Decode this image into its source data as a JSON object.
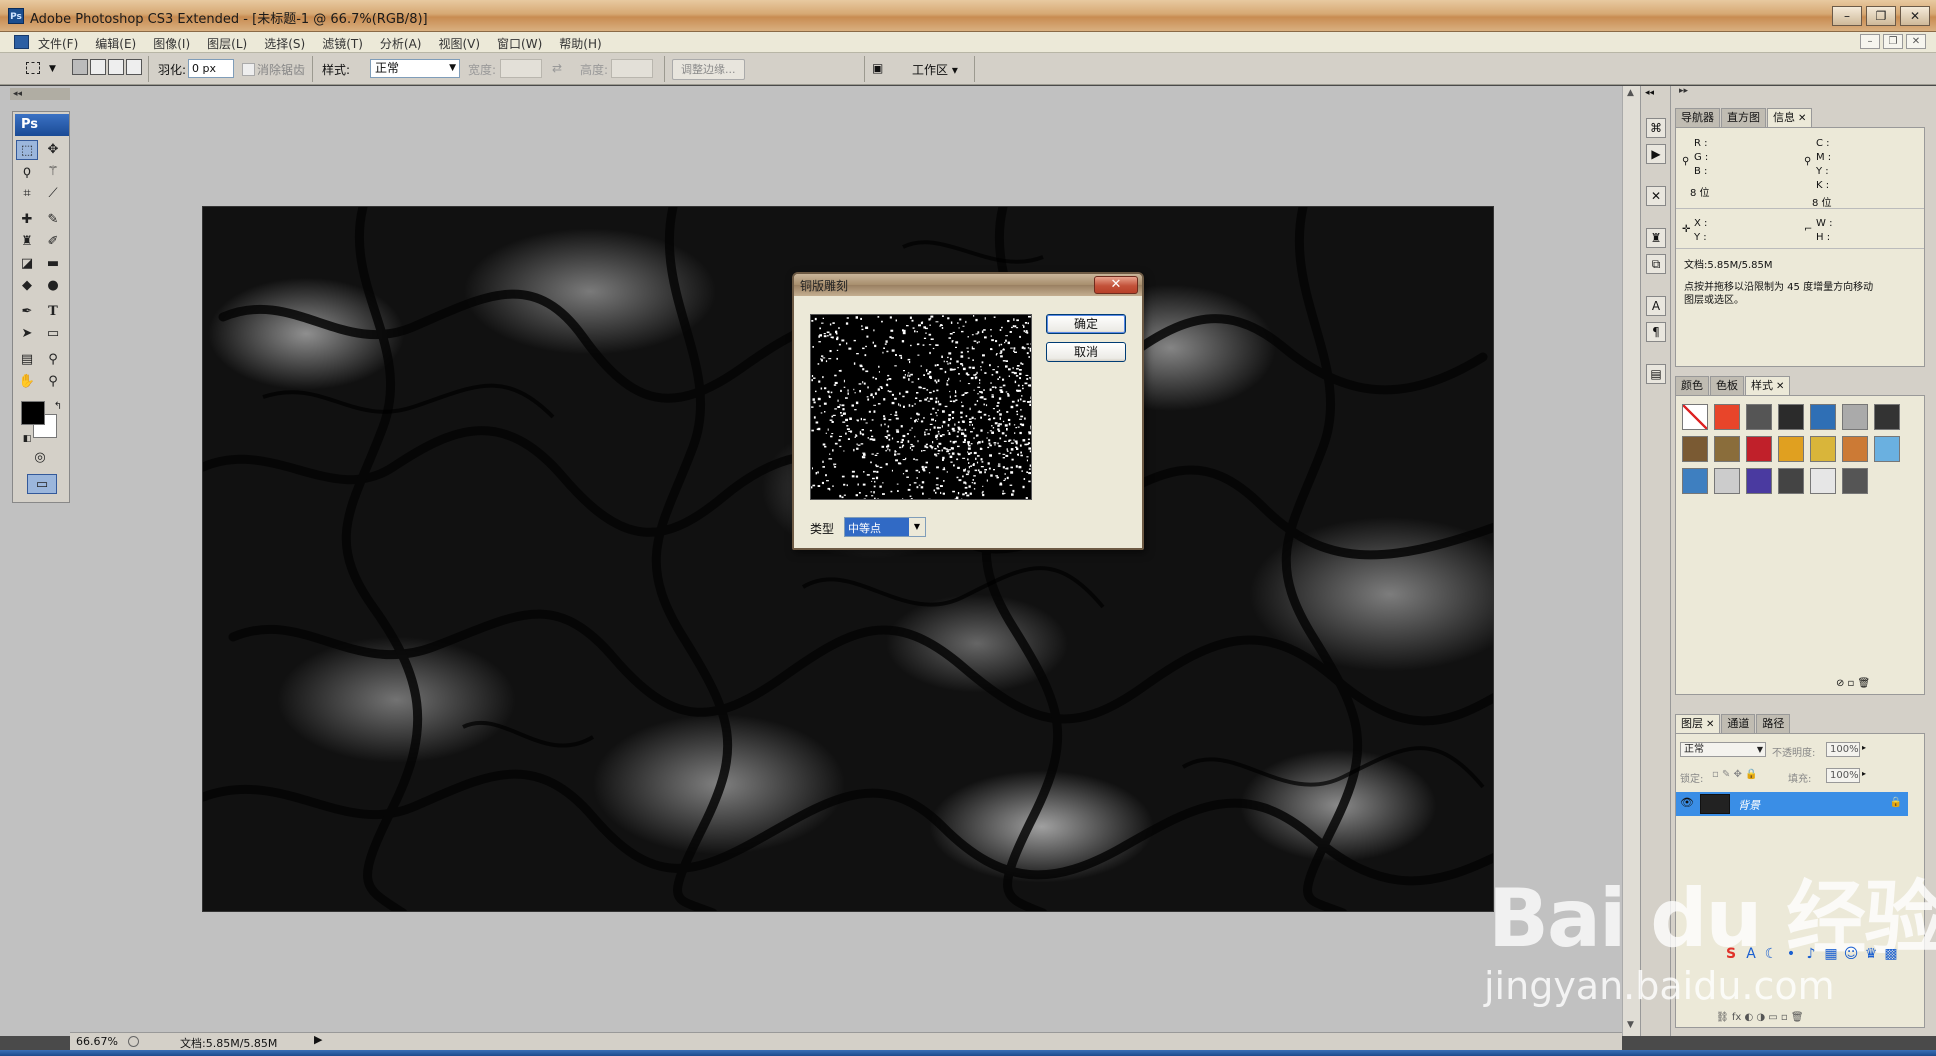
{
  "window": {
    "title": "Adobe Photoshop CS3 Extended - [未标题-1 @ 66.7%(RGB/8)]",
    "badge": "Ps",
    "controls": [
      "–",
      "❐",
      "✕"
    ],
    "mdi_controls": [
      "–",
      "❐",
      "✕"
    ]
  },
  "menu": {
    "items": [
      "文件(F)",
      "编辑(E)",
      "图像(I)",
      "图层(L)",
      "选择(S)",
      "滤镜(T)",
      "分析(A)",
      "视图(V)",
      "窗口(W)",
      "帮助(H)"
    ]
  },
  "options": {
    "feather_label": "羽化:",
    "feather_value": "0 px",
    "antialias_label": "消除锯齿",
    "style_label": "样式:",
    "style_value": "正常",
    "width_label": "宽度:",
    "height_label": "高度:",
    "refine_edge": "调整边缘...",
    "workspace": "工作区 ▾"
  },
  "toolbox": {
    "logo": "Ps"
  },
  "status": {
    "zoom": "66.67%",
    "doc": "文档:5.85M/5.85M"
  },
  "dialog": {
    "title": "铜版雕刻",
    "ok": "确定",
    "cancel": "取消",
    "type_label": "类型",
    "type_value": "中等点"
  },
  "panels": {
    "info_tabs": [
      "导航器",
      "直方图",
      "信息"
    ],
    "info": {
      "r": "R :",
      "g": "G :",
      "b": "B :",
      "c": "C :",
      "m": "M :",
      "y": "Y :",
      "k": "K :",
      "bits_left": "8 位",
      "bits_right": "8 位",
      "x": "X :",
      "ylabel": "Y :",
      "w": "W :",
      "h": "H :",
      "doc": "文档:5.85M/5.85M",
      "hint_1": "点按并拖移以沿限制为 45 度增量方向移动",
      "hint_2": "图层或选区。"
    },
    "style_tabs": [
      "颜色",
      "色板",
      "样式"
    ],
    "style_swatches": [
      "#ffffff",
      "#e8452a",
      "#555555",
      "#2b2b2b",
      "#2f6fb5",
      "#aaaaaa",
      "#333333",
      "#7a5a33",
      "#8a6d3b",
      "#c0202a",
      "#e0a020",
      "#d9b53a",
      "#cc7a35",
      "#6ab0e0",
      "#3e7fc0",
      "#cccccc",
      "#4a3aa0",
      "#444444",
      "#e6e6e6",
      "#555555"
    ],
    "layer_tabs": [
      "图层",
      "通道",
      "路径"
    ],
    "blend_mode": "正常",
    "opacity_label": "不透明度:",
    "opacity_value": "100%",
    "lock_label": "锁定:",
    "fill_label": "填充:",
    "fill_value": "100%",
    "layer_name": "背景"
  },
  "watermark": {
    "logo": "Bai du 经验",
    "url": "jingyan.baidu.com"
  }
}
